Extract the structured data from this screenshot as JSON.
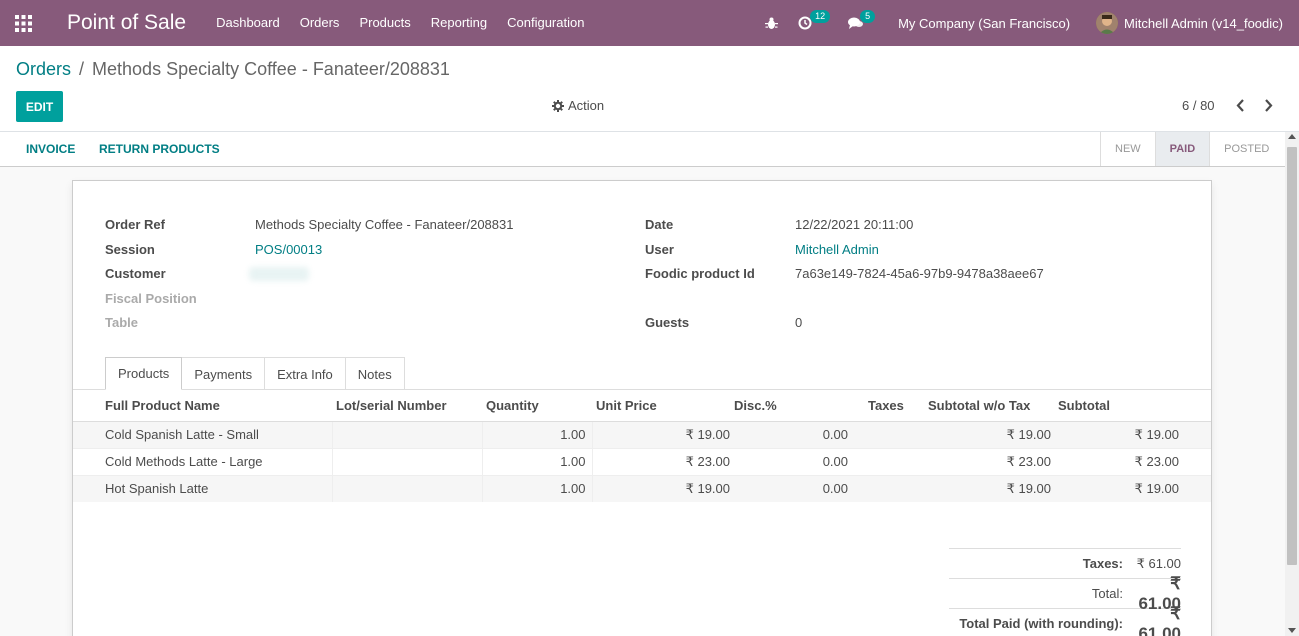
{
  "navbar": {
    "app_title": "Point of Sale",
    "menu": [
      "Dashboard",
      "Orders",
      "Products",
      "Reporting",
      "Configuration"
    ],
    "activity_count": "12",
    "messages_count": "5",
    "company": "My Company (San Francisco)",
    "user": "Mitchell Admin (v14_foodic)"
  },
  "breadcrumb": {
    "parent": "Orders",
    "current": "Methods Specialty Coffee - Fanateer/208831"
  },
  "control": {
    "edit_label": "EDIT",
    "action_label": "Action",
    "pager": "6 / 80"
  },
  "statusbar": {
    "invoice_label": "INVOICE",
    "return_label": "RETURN PRODUCTS",
    "stages": [
      "NEW",
      "PAID",
      "POSTED"
    ],
    "active_stage": "PAID"
  },
  "form": {
    "left": [
      {
        "label": "Order Ref",
        "value": "Methods Specialty Coffee - Fanateer/208831"
      },
      {
        "label": "Session",
        "value": "POS/00013"
      },
      {
        "label": "Customer",
        "value": ""
      },
      {
        "label": "Fiscal Position",
        "value": ""
      },
      {
        "label": "Table",
        "value": ""
      }
    ],
    "right": [
      {
        "label": "Date",
        "value": "12/22/2021 20:11:00"
      },
      {
        "label": "User",
        "value": "Mitchell Admin"
      },
      {
        "label": "Foodic product Id",
        "value": "7a63e149-7824-45a6-97b9-9478a38aee67"
      },
      {
        "label": "Guests",
        "value": "0"
      }
    ]
  },
  "tabs": [
    "Products",
    "Payments",
    "Extra Info",
    "Notes"
  ],
  "lines": {
    "headers": [
      "Full Product Name",
      "Lot/serial Number",
      "Quantity",
      "Unit Price",
      "Disc.%",
      "Taxes",
      "Subtotal w/o Tax",
      "Subtotal"
    ],
    "rows": [
      [
        "Cold Spanish Latte - Small",
        "",
        "1.00",
        "₹ 19.00",
        "0.00",
        "",
        "₹ 19.00",
        "₹ 19.00"
      ],
      [
        "Cold Methods Latte - Large",
        "",
        "1.00",
        "₹ 23.00",
        "0.00",
        "",
        "₹ 23.00",
        "₹ 23.00"
      ],
      [
        "Hot Spanish Latte",
        "",
        "1.00",
        "₹ 19.00",
        "0.00",
        "",
        "₹ 19.00",
        "₹ 19.00"
      ]
    ]
  },
  "totals": {
    "taxes_label": "Taxes:",
    "taxes_value": "₹ 61.00",
    "total_label": "Total:",
    "total_value": "₹ 61.00",
    "paid_label": "Total Paid (with rounding):",
    "paid_value": "₹ 61.00"
  },
  "colors": {
    "navbar": "#875a7b",
    "primary": "#00a09d",
    "link": "#017e84"
  },
  "icons": {
    "apps": "apps-grid-icon",
    "bug": "bug-icon",
    "activity": "clock-icon",
    "messages": "comments-icon",
    "gear": "gear-icon",
    "prev": "chevron-left-icon",
    "next": "chevron-right-icon"
  }
}
